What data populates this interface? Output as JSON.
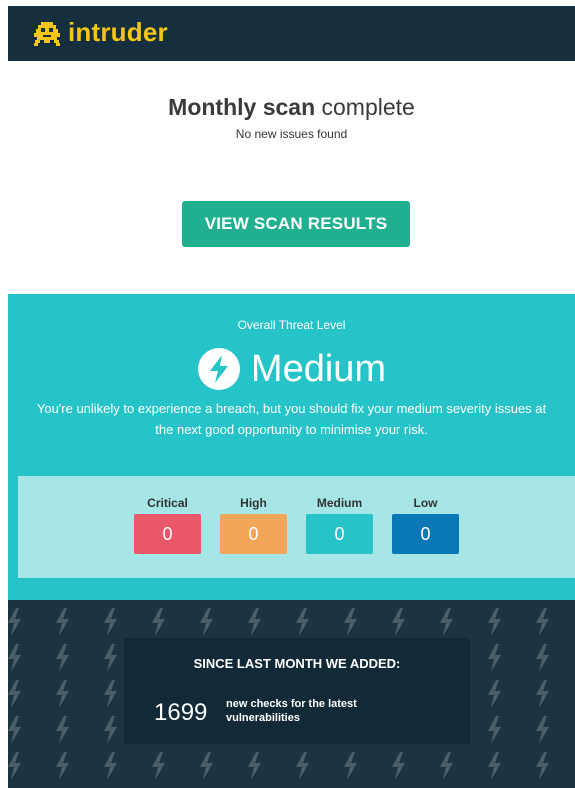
{
  "brand": {
    "name": "intruder",
    "logo_icon": "invader-icon",
    "color": "#f5c518"
  },
  "scan": {
    "title_bold": "Monthly scan",
    "title_rest": "complete",
    "subtitle": "No new issues found"
  },
  "cta": {
    "label": "VIEW SCAN RESULTS",
    "color": "#20b090"
  },
  "threat": {
    "label": "Overall Threat Level",
    "level": "Medium",
    "level_icon": "lightning-icon",
    "description_line1": "You're unlikely to experience a breach, but you should fix your medium severity issues at",
    "description_line2": "the next good opportunity to minimise your risk.",
    "background": "#26c4c8"
  },
  "counts": [
    {
      "label": "Critical",
      "value": "0",
      "color": "#e8586a"
    },
    {
      "label": "High",
      "value": "0",
      "color": "#f2a65a"
    },
    {
      "label": "Medium",
      "value": "0",
      "color": "#26c4c8"
    },
    {
      "label": "Low",
      "value": "0",
      "color": "#0a77b6"
    }
  ],
  "added": {
    "title": "SINCE LAST MONTH WE ADDED:",
    "count": "1699",
    "text": "new checks for the latest vulnerabilities"
  }
}
